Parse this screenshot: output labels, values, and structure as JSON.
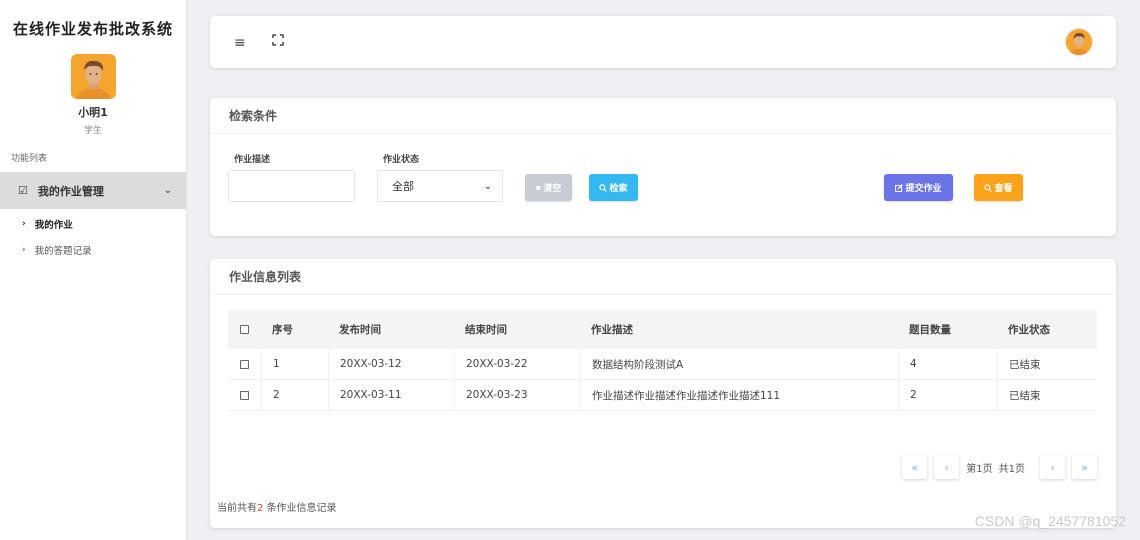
{
  "sidebar": {
    "app_title": "在线作业发布批改系统",
    "user_name": "小明1",
    "user_role": "学生",
    "section_label": "功能列表",
    "group_label": "我的作业管理",
    "items": [
      {
        "label": "我的作业",
        "active": true
      },
      {
        "label": "我的答题记录",
        "active": false
      }
    ]
  },
  "topbar": {
    "icons": [
      "menu-icon",
      "fullscreen-icon"
    ]
  },
  "search": {
    "title": "检索条件",
    "desc_label": "作业描述",
    "desc_value": "",
    "status_label": "作业状态",
    "status_value": "全部",
    "clear_label": "清空",
    "search_label": "检索",
    "submit_label": "提交作业",
    "view_label": "查看"
  },
  "list": {
    "title": "作业信息列表",
    "columns": [
      "序号",
      "发布时间",
      "结束时间",
      "作业描述",
      "题目数量",
      "作业状态"
    ],
    "rows": [
      [
        "1",
        "20XX-03-12",
        "20XX-03-22",
        "数据结构阶段测试A",
        "4",
        "已结束"
      ],
      [
        "2",
        "20XX-03-11",
        "20XX-03-23",
        "作业描述作业描述作业描述作业描述111",
        "2",
        "已结束"
      ]
    ]
  },
  "pagination": {
    "page_text": "第1页",
    "total_pages_text": "共1页"
  },
  "footer": {
    "total_prefix": "当前共有",
    "total_count": "2",
    "total_suffix": " 条作业信息记录"
  },
  "watermark": "CSDN @q_2457781052",
  "colors": {
    "search_button": "#35b8f2",
    "submit_button": "#6a73e8",
    "view_button": "#faa31b",
    "clear_button": "#c7cbd3",
    "count_highlight": "#e0463c"
  }
}
